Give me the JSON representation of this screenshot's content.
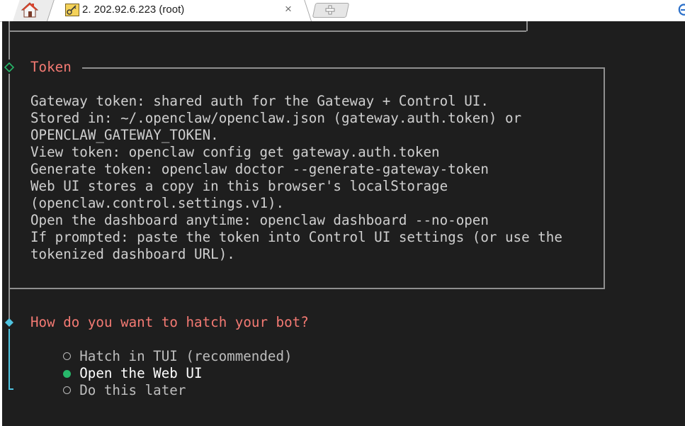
{
  "tabs": {
    "home_icon": "home-icon",
    "session": {
      "key_icon": "key-icon",
      "title": "2. 202.92.6.223 (root)",
      "close_label": "×"
    },
    "new_tab_icon": "plus-icon"
  },
  "colors": {
    "background": "#1e1e1e",
    "text": "#cfcfcf",
    "accent": "#f47a73",
    "diamond_green": "#27b86a",
    "diamond_cyan": "#4fc3e0",
    "selected": "#27b86a"
  },
  "terminal": {
    "note_box": {
      "title": "Token",
      "lines": [
        "Gateway token: shared auth for the Gateway + Control UI.",
        "Stored in: ~/.openclaw/openclaw.json (gateway.auth.token) or",
        "OPENCLAW_GATEWAY_TOKEN.",
        "View token: openclaw config get gateway.auth.token",
        "Generate token: openclaw doctor --generate-gateway-token",
        "Web UI stores a copy in this browser's localStorage",
        "(openclaw.control.settings.v1).",
        "Open the dashboard anytime: openclaw dashboard --no-open",
        "If prompted: paste the token into Control UI settings (or use the",
        "tokenized dashboard URL)."
      ]
    },
    "prompt": {
      "question": "How do you want to hatch your bot?",
      "options": [
        {
          "label": "Hatch in TUI (recommended)",
          "selected": false
        },
        {
          "label": "Open the Web UI",
          "selected": true
        },
        {
          "label": "Do this later",
          "selected": false
        }
      ]
    }
  }
}
